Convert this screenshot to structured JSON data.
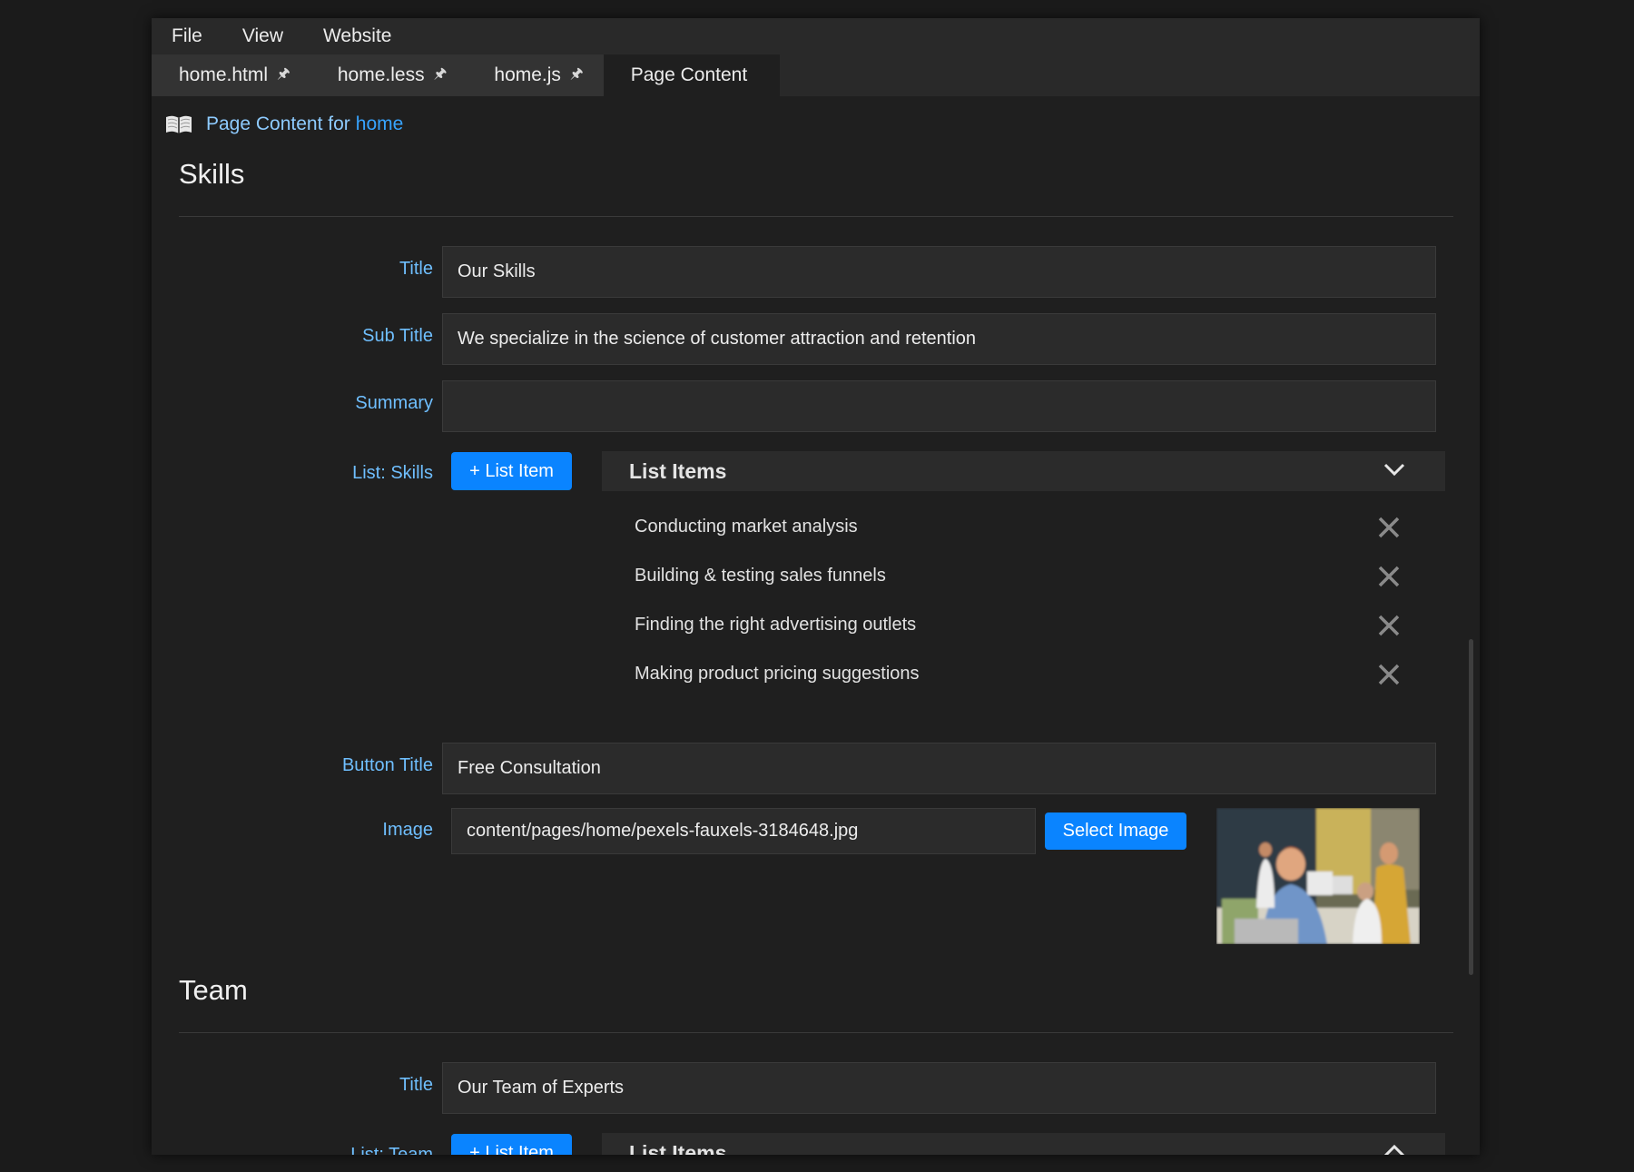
{
  "menu": {
    "items": [
      "File",
      "View",
      "Website"
    ]
  },
  "tabs": [
    {
      "label": "home.html",
      "pinned": true
    },
    {
      "label": "home.less",
      "pinned": true
    },
    {
      "label": "home.js",
      "pinned": true
    },
    {
      "label": "Page Content",
      "pinned": false,
      "active": true
    }
  ],
  "breadcrumb": {
    "prefix": "Page Content for",
    "page": "home",
    "icon": "book-icon"
  },
  "skills": {
    "heading": "Skills",
    "title_label": "Title",
    "title_value": "Our Skills",
    "subtitle_label": "Sub Title",
    "subtitle_value": "We specialize in the science of customer attraction and retention",
    "summary_label": "Summary",
    "summary_value": "",
    "list_label": "List: Skills",
    "add_item_label": "+ List Item",
    "list_header": "List Items",
    "items": [
      "Conducting market analysis",
      "Building & testing sales funnels",
      "Finding the right advertising outlets",
      "Making product pricing suggestions"
    ],
    "button_title_label": "Button Title",
    "button_title_value": "Free Consultation",
    "image_label": "Image",
    "image_value": "content/pages/home/pexels-fauxels-3184648.jpg",
    "select_image_label": "Select Image"
  },
  "team": {
    "heading": "Team",
    "title_label": "Title",
    "title_value": "Our Team of Experts",
    "list_label": "List: Team",
    "add_item_label": "+ List Item",
    "list_header": "List Items"
  },
  "colors": {
    "accent": "#0a84ff",
    "label": "#6fbfff",
    "background": "#1f1f1f",
    "field": "#2b2b2b"
  }
}
